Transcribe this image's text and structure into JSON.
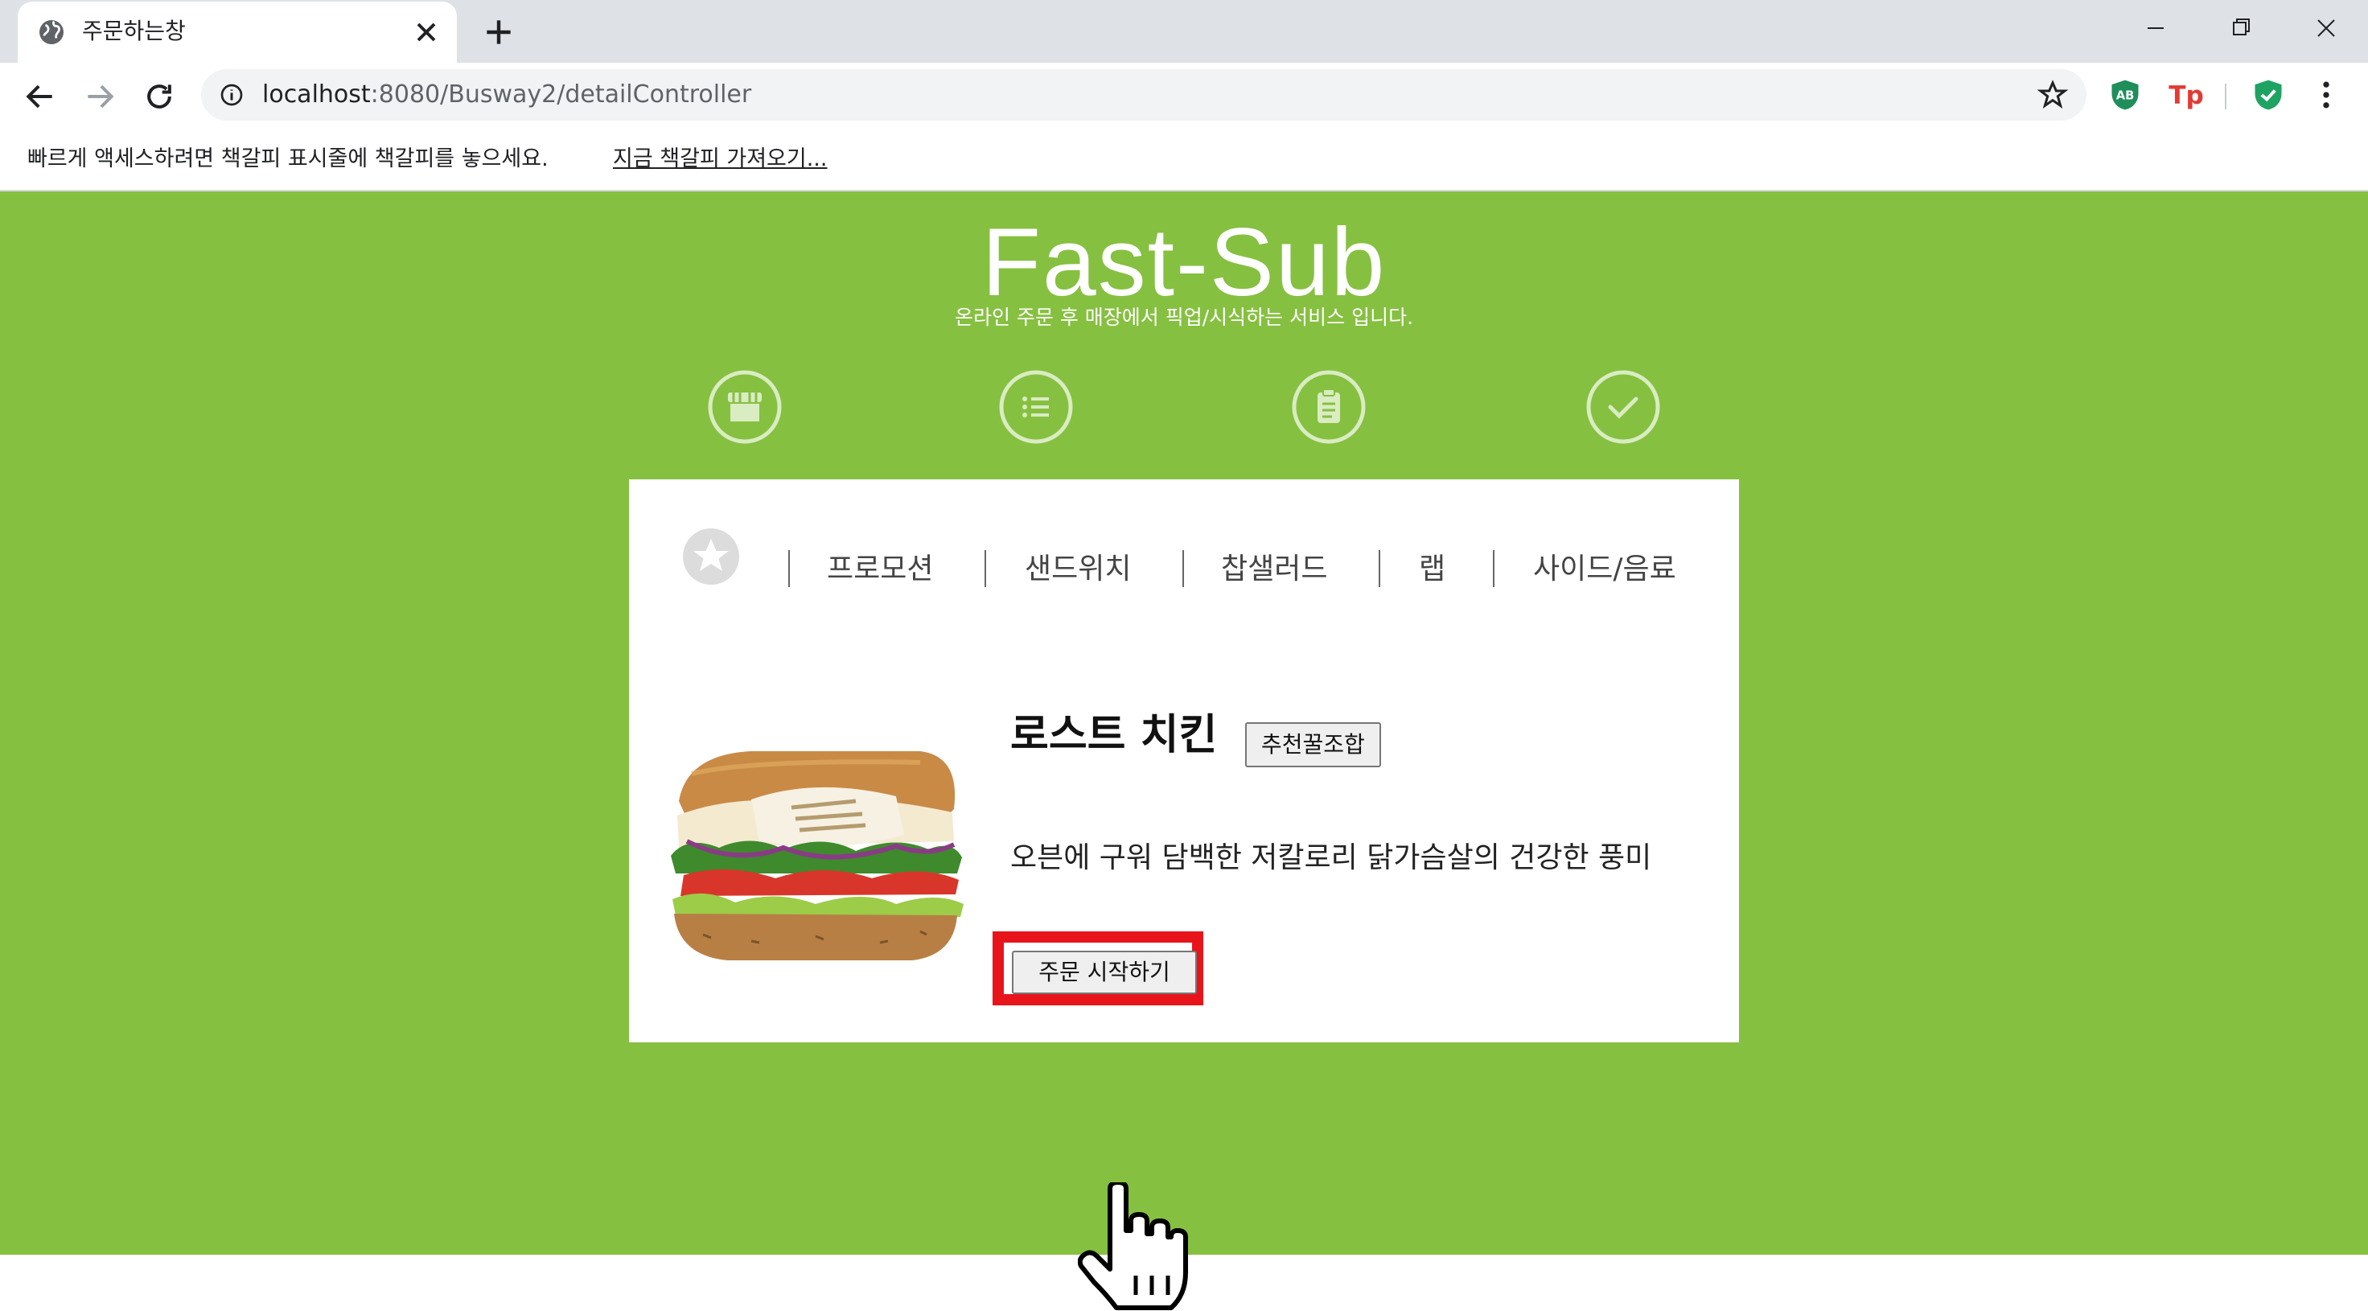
{
  "browser": {
    "tab_title": "주문하는창",
    "url_host": "localhost",
    "url_rest": ":8080/Busway2/detailController",
    "bookmark_message": "빠르게 액세스하려면 책갈피 표시줄에 책갈피를 놓으세요.",
    "bookmark_link": "지금 책갈피 가져오기...",
    "extensions": [
      "adblock-icon",
      "tp-icon",
      "shield-check-icon"
    ]
  },
  "site": {
    "title": "Fast-Sub",
    "subtitle": "온라인 주문 후 매장에서 픽업/시식하는 서비스 입니다.",
    "steps": [
      "store-icon",
      "list-icon",
      "clipboard-icon",
      "check-icon"
    ],
    "accent_color": "#86c040"
  },
  "categories": [
    "프로모션",
    "샌드위치",
    "찹샐러드",
    "랩",
    "사이드/음료"
  ],
  "product": {
    "name": "로스트 치킨",
    "combo_button": "추천꿀조합",
    "description": "오븐에 구워 담백한 저칼로리 닭가슴살의 건강한 풍미",
    "start_button": "주문 시작하기",
    "highlight_color": "#e8141c"
  }
}
